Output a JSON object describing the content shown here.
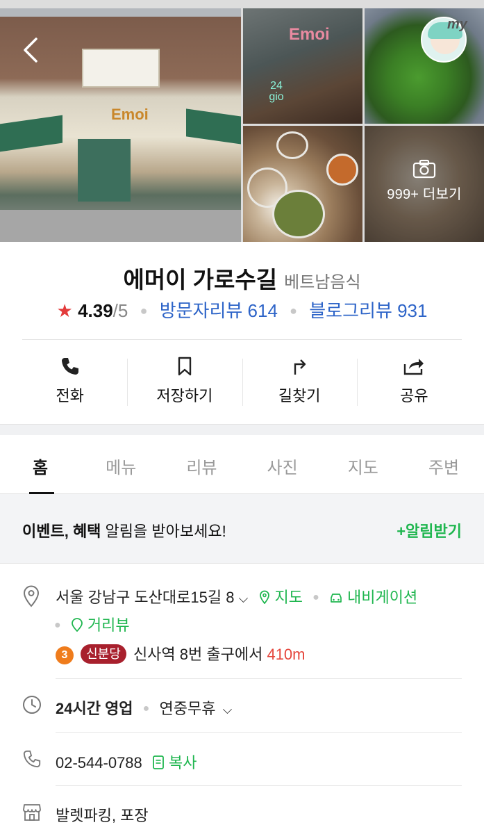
{
  "photos": {
    "more_label": "999+ 더보기",
    "avatar_tag": "my",
    "sign_logo": "Emoi",
    "neon_sign": "24 gio",
    "shop_logo": "Emoi"
  },
  "place": {
    "name": "에머이 가로수길",
    "category": "베트남음식",
    "rating": "4.39",
    "rating_max": "/5",
    "visitor_reviews": "방문자리뷰 614",
    "blog_reviews": "블로그리뷰 931"
  },
  "actions": [
    {
      "label": "전화",
      "icon": "phone-icon"
    },
    {
      "label": "저장하기",
      "icon": "bookmark-icon"
    },
    {
      "label": "길찾기",
      "icon": "directions-icon"
    },
    {
      "label": "공유",
      "icon": "share-icon"
    }
  ],
  "tabs": [
    "홈",
    "메뉴",
    "리뷰",
    "사진",
    "지도",
    "주변"
  ],
  "active_tab": "홈",
  "banner": {
    "bold_text": "이벤트, 혜택",
    "text": " 알림을 받아보세요!",
    "button": "+알림받기"
  },
  "info": {
    "address": "서울 강남구 도산대로15길 8",
    "map_link": "지도",
    "navigation_link": "내비게이션",
    "street_view_link": "거리뷰",
    "subway_line": "3",
    "subway_badge": "신분당",
    "subway_text": "신사역 8번 출구에서",
    "subway_distance": "410m",
    "hours": "24시간 영업",
    "hours_note": "연중무휴",
    "phone": "02-544-0788",
    "copy_label": "복사",
    "amenities": "발렛파킹, 포장"
  },
  "colors": {
    "link_blue": "#2d64c8",
    "accent_green": "#1fb64f",
    "star_red": "#e33b3b",
    "line3_orange": "#ef7c1c",
    "sinbundang_red": "#a8202d"
  }
}
